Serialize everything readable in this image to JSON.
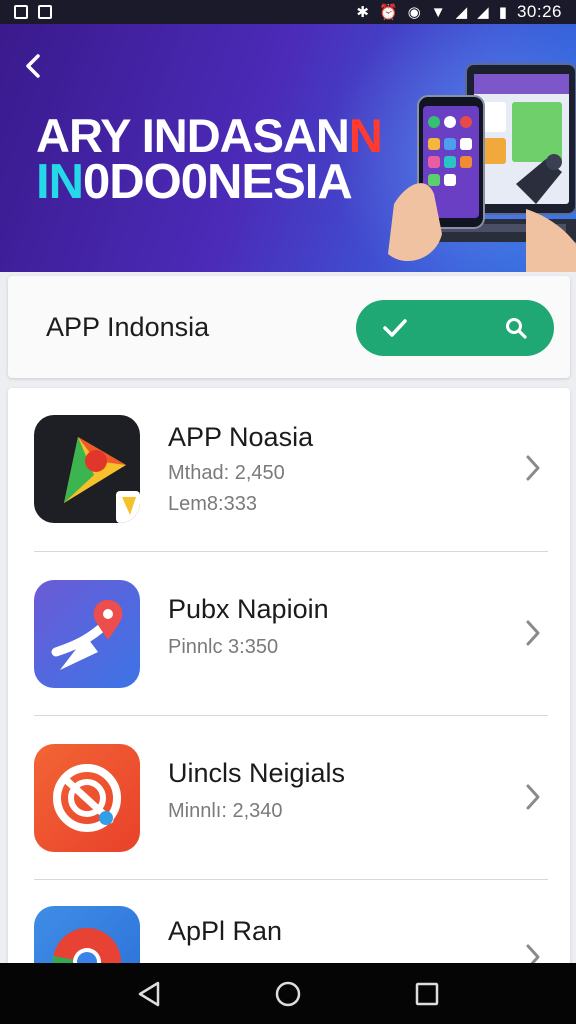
{
  "status_bar": {
    "time": "30:26"
  },
  "banner": {
    "title_line1_main": "ARY INDASAN",
    "title_line1_accent": "N",
    "title_line2_accent": "IN",
    "title_line2_main": "0DO0NESIA"
  },
  "search": {
    "label": "APP Indonsia"
  },
  "apps": [
    {
      "title": "APP Noasia",
      "line1": "Mthad: 2,450",
      "line2": "Lem8:333"
    },
    {
      "title": "Pubx Napioin",
      "line1": "Pinnlc 3:350"
    },
    {
      "title": "Uincls Neigials",
      "line1": "Minnlı: 2,340"
    },
    {
      "title": "ApPl Ran"
    }
  ],
  "colors": {
    "accent_green": "#1fa774",
    "banner_purple": "#4b2bb8",
    "title_red": "#ff3b2f",
    "title_cyan": "#26d9e8"
  }
}
